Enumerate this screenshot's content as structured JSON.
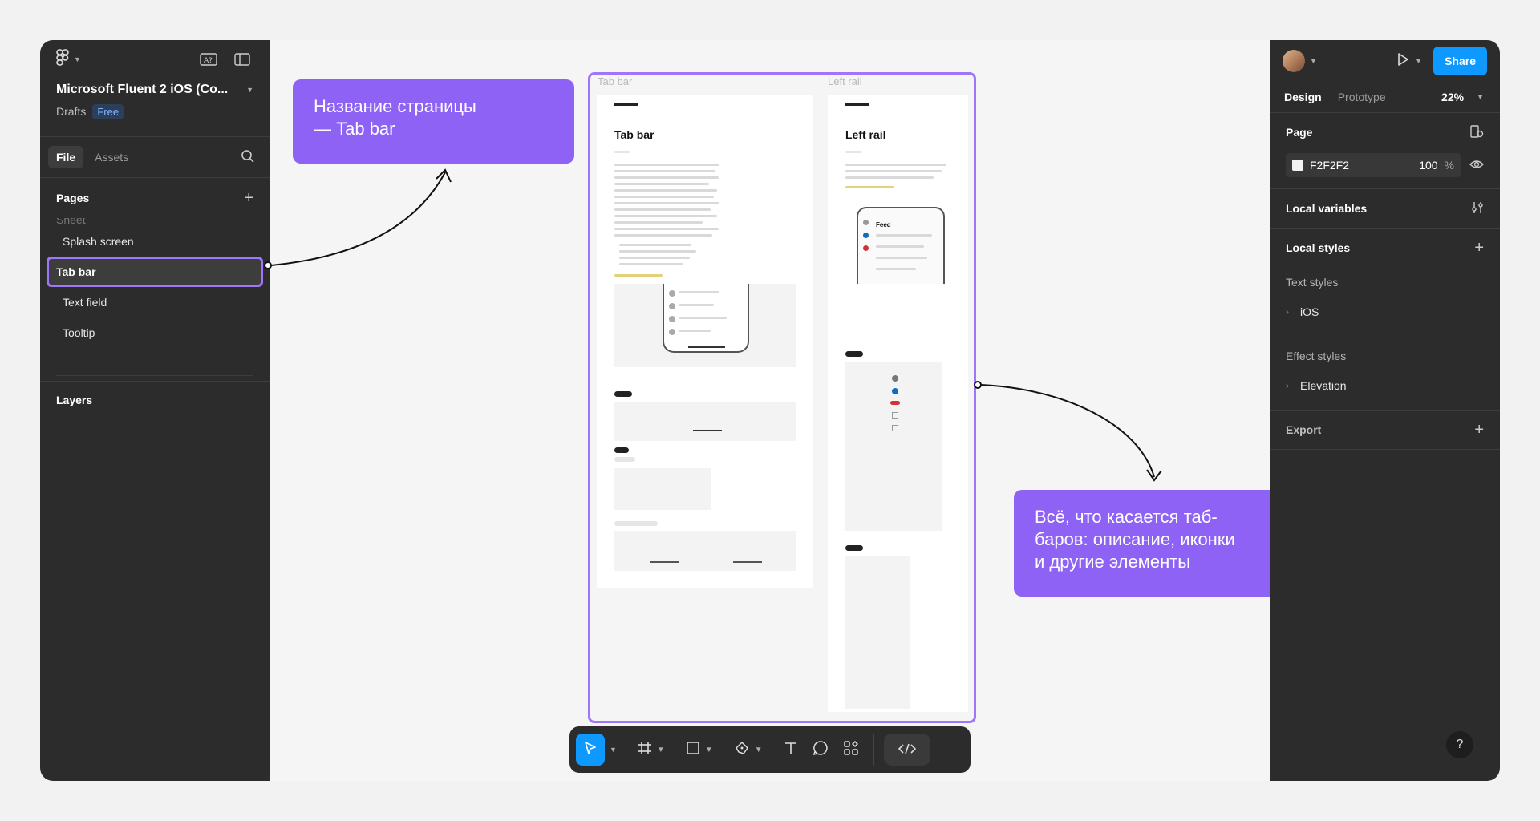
{
  "file": {
    "title": "Microsoft Fluent 2 iOS (Co...",
    "location": "Drafts",
    "plan": "Free"
  },
  "left_tabs": {
    "file": "File",
    "assets": "Assets"
  },
  "pages": {
    "heading": "Pages",
    "cut_item": "Sheet",
    "items": [
      "Splash screen",
      "Tab bar",
      "Text field",
      "Tooltip"
    ]
  },
  "layers": {
    "heading": "Layers"
  },
  "right": {
    "share": "Share",
    "tabs": {
      "design": "Design",
      "prototype": "Prototype",
      "zoom": "22%"
    },
    "page_heading": "Page",
    "page_color": "F2F2F2",
    "page_opacity": "100",
    "percent": "%",
    "local_variables": "Local variables",
    "local_styles": "Local styles",
    "text_styles": "Text styles",
    "text_style_item": "iOS",
    "effect_styles": "Effect styles",
    "effect_style_item": "Elevation",
    "export": "Export",
    "help": "?"
  },
  "canvas": {
    "frame_label_1": "Tab bar",
    "frame_label_2": "Left rail",
    "mock1_title": "Tab bar",
    "mock2_title": "Left rail",
    "mock2_feed": "Feed"
  },
  "callouts": {
    "page_name": "Название страницы\n— Tab bar",
    "description": "Всё, что касается таб-\nбаров: описание, иконки\nи другие элементы"
  },
  "colors": {
    "accent": "#9f76fa",
    "callout": "#8d62f5",
    "share": "#0d99ff",
    "panel": "#2c2c2c"
  }
}
